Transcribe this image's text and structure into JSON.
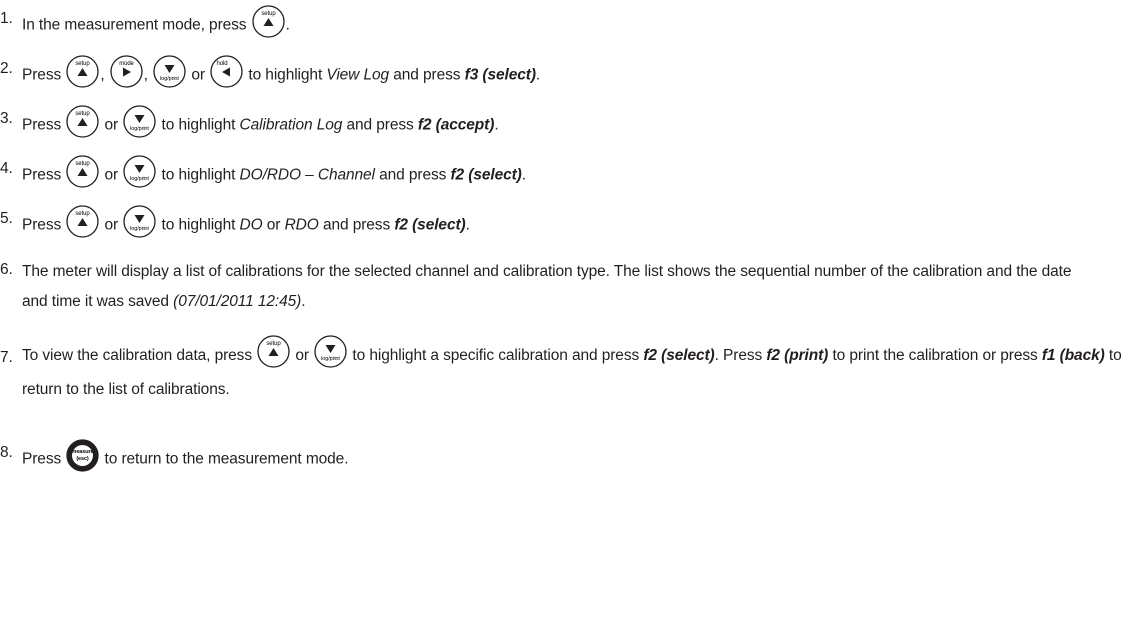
{
  "steps": [
    {
      "num": "1.",
      "t1": "In the measurement mode, press ",
      "t2": "."
    },
    {
      "num": "2.",
      "t1": "Press ",
      "sep1": ", ",
      "sep2": ", ",
      "sep3": " or ",
      "t2": " to highlight ",
      "item": "View Log",
      "t3": " and press ",
      "action": "f3 (select)",
      "t4": "."
    },
    {
      "num": "3.",
      "t1": "Press ",
      "sep1": " or ",
      "t2": " to highlight ",
      "item": "Calibration Log",
      "t3": " and press ",
      "action": "f2 (accept)",
      "t4": "."
    },
    {
      "num": "4.",
      "t1": "Press ",
      "sep1": " or ",
      "t2": " to highlight ",
      "item": "DO/RDO – Channel",
      "t3": " and press ",
      "action": "f2 (select)",
      "t4": "."
    },
    {
      "num": "5.",
      "t1": "Press ",
      "sep1": " or ",
      "t2": " to highlight ",
      "item1": "DO",
      "mid": " or ",
      "item2": "RDO",
      "t3": " and press ",
      "action": "f2 (select)",
      "t4": "."
    },
    {
      "num": "6.",
      "t1": "The meter will display a list of calibrations for the selected channel and calibration type. The list shows the sequential number of the calibration and the date and time it was saved ",
      "stamp": "(07/01/2011 12:45)",
      "t2": "."
    },
    {
      "num": "7.",
      "t1": "To view the calibration data, press ",
      "sep1": " or ",
      "t2": " to highlight a specific calibration and press ",
      "action1": "f2 (select)",
      "t3": ". Press ",
      "action2_a": "f2",
      "action2_b": "(print)",
      "t4": " to print the calibration or press ",
      "action3": "f1 (back)",
      "t5": " to return to the list of calibrations."
    },
    {
      "num": "8.",
      "t1": "Press ",
      "t2": " to return to the measurement mode."
    }
  ],
  "keys": {
    "setup": "setup",
    "mode": "mode",
    "log": "log/print",
    "hold": "hold",
    "measure": "measure",
    "esc": "(esc)"
  }
}
